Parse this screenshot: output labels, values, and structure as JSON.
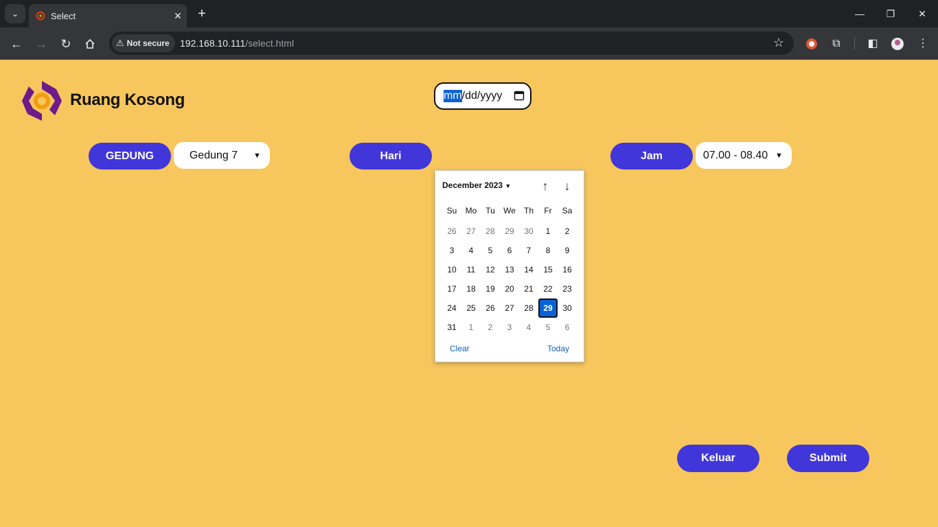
{
  "browser": {
    "tab_title": "Select",
    "security_label": "Not secure",
    "url_host": "192.168.10.111",
    "url_path": "/select.html"
  },
  "page": {
    "brand_name": "Ruang Kosong",
    "gedung": {
      "label": "GEDUNG",
      "selected": "Gedung 7"
    },
    "hari": {
      "label": "Hari",
      "month_placeholder": "mm",
      "rest_placeholder": "/dd/yyyy"
    },
    "jam": {
      "label": "Jam",
      "selected": "07.00 - 08.40"
    },
    "keluar_label": "Keluar",
    "submit_label": "Submit"
  },
  "datepicker": {
    "month_label": "December 2023",
    "weekdays": [
      "Su",
      "Mo",
      "Tu",
      "We",
      "Th",
      "Fr",
      "Sa"
    ],
    "weeks": [
      [
        "26",
        "27",
        "28",
        "29",
        "30",
        "1",
        "2"
      ],
      [
        "3",
        "4",
        "5",
        "6",
        "7",
        "8",
        "9"
      ],
      [
        "10",
        "11",
        "12",
        "13",
        "14",
        "15",
        "16"
      ],
      [
        "17",
        "18",
        "19",
        "20",
        "21",
        "22",
        "23"
      ],
      [
        "24",
        "25",
        "26",
        "27",
        "28",
        "29",
        "30"
      ],
      [
        "31",
        "1",
        "2",
        "3",
        "4",
        "5",
        "6"
      ]
    ],
    "selected_day": "29",
    "clear_label": "Clear",
    "today_label": "Today"
  },
  "colors": {
    "page_bg": "#f7c65c",
    "accent": "#4136d9",
    "selected_day": "#0a63d6"
  }
}
